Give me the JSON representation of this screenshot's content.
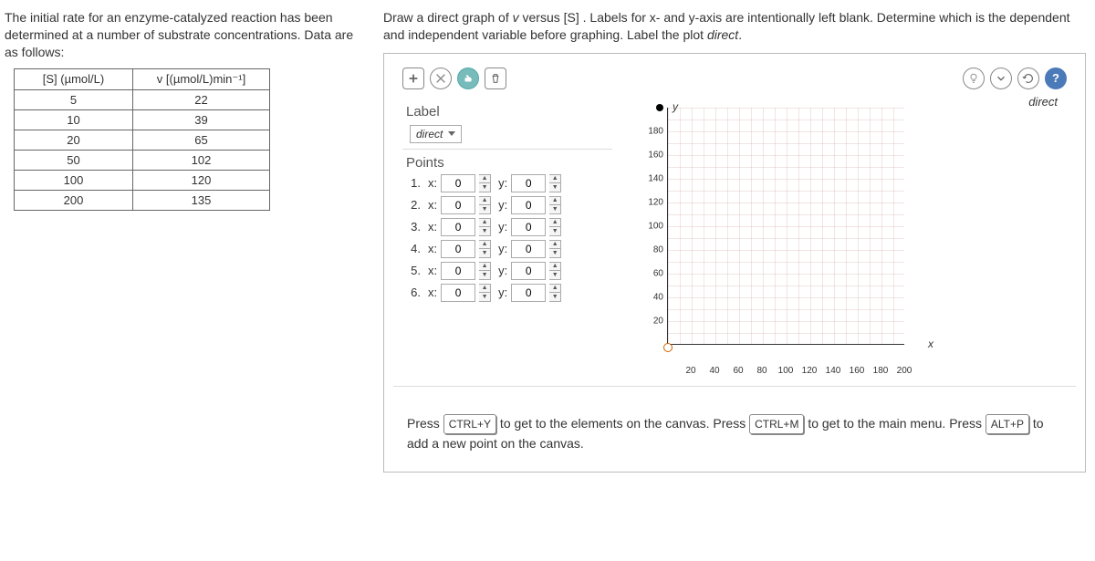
{
  "prompt": "The initial rate for an enzyme-catalyzed reaction has been determined at a number of substrate concentrations. Data are as follows:",
  "table": {
    "headers": [
      "[S]  (µmol/L)",
      "v [(µmol/L)min⁻¹]"
    ],
    "rows": [
      [
        "5",
        "22"
      ],
      [
        "10",
        "39"
      ],
      [
        "20",
        "65"
      ],
      [
        "50",
        "102"
      ],
      [
        "100",
        "120"
      ],
      [
        "200",
        "135"
      ]
    ]
  },
  "instruction_pre": "Draw a direct graph of ",
  "instruction_v": "v",
  "instruction_mid": " versus [S] . Labels for ",
  "instruction_xy": "x- and y-axis",
  "instruction_post": " are intentionally left blank. Determine which is the dependent and independent variable before graphing. Label the plot ",
  "instruction_label": "direct",
  "period": ".",
  "sections": {
    "label": "Label",
    "points": "Points"
  },
  "label_dropdown": "direct",
  "points": [
    {
      "n": "1.",
      "xl": "x:",
      "x": "0",
      "yl": "y:",
      "y": "0"
    },
    {
      "n": "2.",
      "xl": "x:",
      "x": "0",
      "yl": "y:",
      "y": "0"
    },
    {
      "n": "3.",
      "xl": "x:",
      "x": "0",
      "yl": "y:",
      "y": "0"
    },
    {
      "n": "4.",
      "xl": "x:",
      "x": "0",
      "yl": "y:",
      "y": "0"
    },
    {
      "n": "5.",
      "xl": "x:",
      "x": "0",
      "yl": "y:",
      "y": "0"
    },
    {
      "n": "6.",
      "xl": "x:",
      "x": "0",
      "yl": "y:",
      "y": "0"
    }
  ],
  "plot_label": "direct",
  "axis": {
    "y": "y",
    "x": "x"
  },
  "y_ticks": [
    "180",
    "160",
    "140",
    "120",
    "100",
    "80",
    "60",
    "40",
    "20"
  ],
  "x_ticks": [
    "20",
    "40",
    "60",
    "80",
    "100",
    "120",
    "140",
    "160",
    "180",
    "200"
  ],
  "shortcut_hint": {
    "p1a": "Press ",
    "k1": "CTRL+Y",
    "p1b": " to get to the elements on the canvas. Press ",
    "k2": "CTRL+M",
    "p1c": " to get to the main menu. Press ",
    "k3": "ALT+P",
    "p1d": " to add a new point on the canvas."
  },
  "chart_data": {
    "type": "scatter",
    "title": "direct",
    "xlabel": "",
    "ylabel": "",
    "xlim": [
      0,
      210
    ],
    "ylim": [
      0,
      200
    ],
    "series": [
      {
        "name": "points",
        "x": [
          0,
          0,
          0,
          0,
          0,
          0
        ],
        "y": [
          0,
          0,
          0,
          0,
          0,
          0
        ]
      }
    ],
    "x_ticks": [
      20,
      40,
      60,
      80,
      100,
      120,
      140,
      160,
      180,
      200
    ],
    "y_ticks": [
      20,
      40,
      60,
      80,
      100,
      120,
      140,
      160,
      180
    ]
  }
}
